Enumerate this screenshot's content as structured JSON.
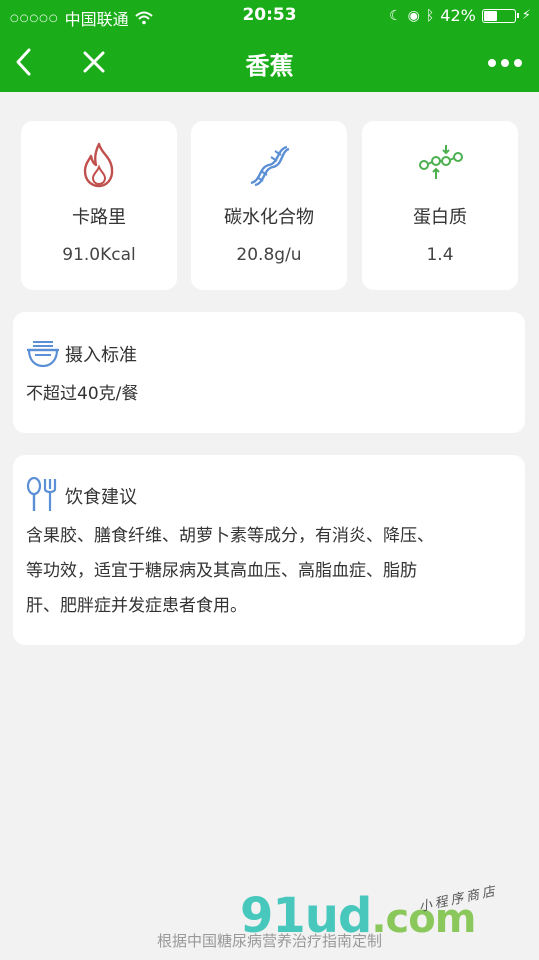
{
  "status_bar": {
    "carrier": "中国联通",
    "time": "20:53",
    "battery": "42%",
    "battery_level": 0.42
  },
  "nav": {
    "title": "香蕉"
  },
  "nutrients": [
    {
      "label": "卡路里",
      "value": "91.0Kcal",
      "icon": "flame-icon",
      "color": "#c0504d"
    },
    {
      "label": "碳水化合物",
      "value": "20.8g/u",
      "icon": "dna-icon",
      "color": "#5b8fd6"
    },
    {
      "label": "蛋白质",
      "value": "1.4",
      "icon": "molecule-icon",
      "color": "#4caf50"
    }
  ],
  "intake": {
    "title": "摄入标准",
    "text": "不超过40克/餐",
    "icon": "bowl-icon"
  },
  "advice": {
    "title": "饮食建议",
    "lines": [
      "含果胶、膳食纤维、胡萝卜素等成分，有消炎、降压、",
      "等功效，适宜于糖尿病及其高血压、高脂血症、脂肪",
      "肝、肥胖症并发症患者食用。"
    ],
    "icon": "spoon-fork-icon"
  },
  "footer": {
    "text": "根据中国糖尿病营养治疗指南定制"
  },
  "watermark": {
    "main": "91ud",
    "domain": ".com",
    "small": "小程序商店"
  },
  "colors": {
    "brand_green": "#1aad19",
    "background": "#f2f2f2"
  }
}
